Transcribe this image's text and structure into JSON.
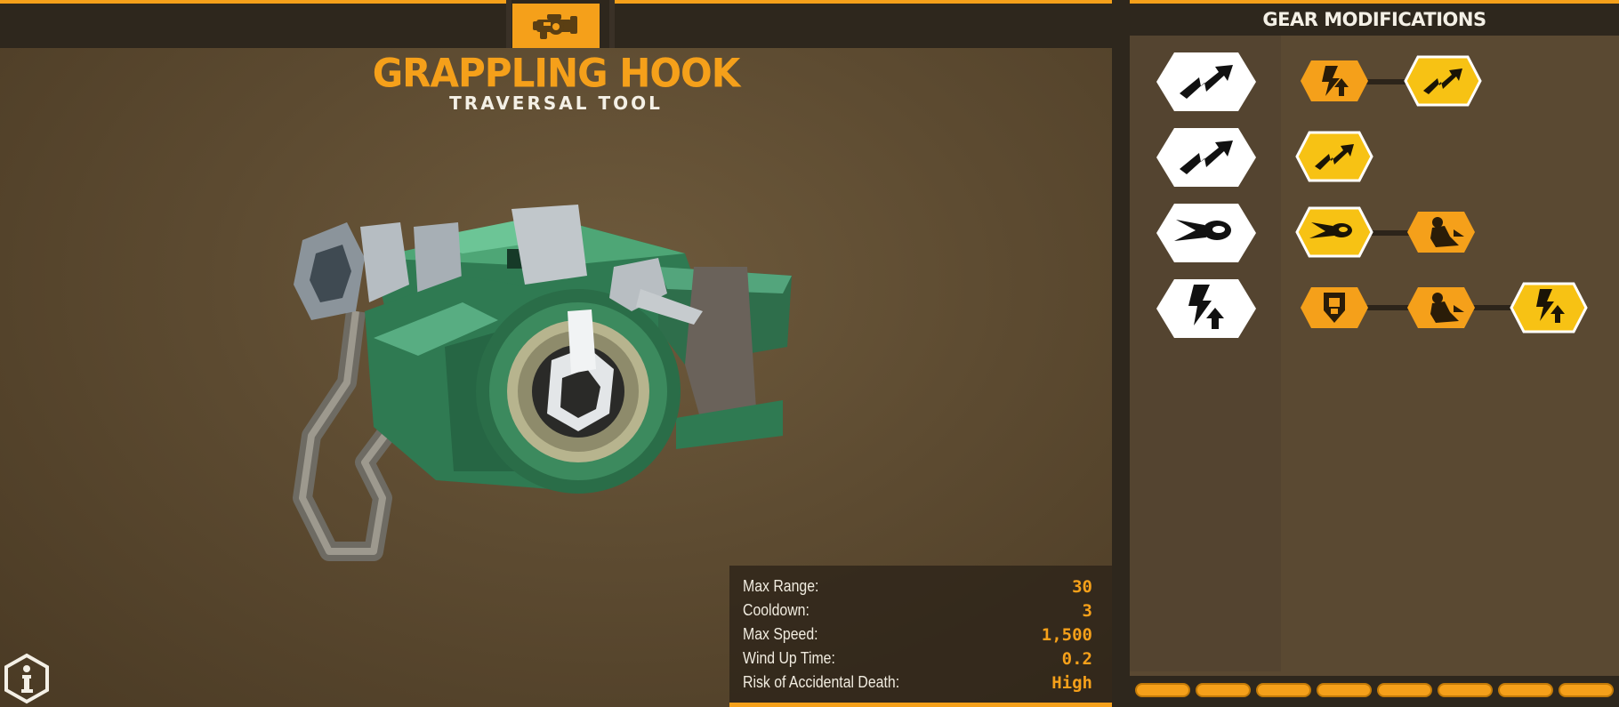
{
  "item": {
    "title": "GRAPPLING HOOK",
    "subtitle": "TRAVERSAL TOOL",
    "category_icon": "gadget-category-icon"
  },
  "stats": [
    {
      "label": "Max Range:",
      "value": "30"
    },
    {
      "label": "Cooldown:",
      "value": "3"
    },
    {
      "label": "Max Speed:",
      "value": "1,500"
    },
    {
      "label": "Wind Up Time:",
      "value": "0.2"
    },
    {
      "label": "Risk of Accidental Death:",
      "value": "High"
    }
  ],
  "panel": {
    "title": "GEAR MODIFICATIONS",
    "rows": [
      {
        "base": "zigzag-arrow-icon",
        "mods": [
          {
            "icon": "lightning-up-icon",
            "style": "orange"
          },
          {
            "icon": "zigzag-arrow-icon",
            "style": "yellow-selected"
          }
        ]
      },
      {
        "base": "zigzag-arrow-icon",
        "mods": [
          {
            "icon": "zigzag-arrow-icon",
            "style": "yellow-selected"
          }
        ]
      },
      {
        "base": "comet-icon",
        "mods": [
          {
            "icon": "comet-icon",
            "style": "yellow-selected"
          },
          {
            "icon": "dash-figure-icon",
            "style": "orange"
          }
        ]
      },
      {
        "base": "lightning-up-icon",
        "mods": [
          {
            "icon": "shield-fist-icon",
            "style": "orange"
          },
          {
            "icon": "dash-figure-icon",
            "style": "orange"
          },
          {
            "icon": "lightning-up-icon",
            "style": "yellow-selected"
          }
        ]
      }
    ]
  },
  "colors": {
    "accent": "#f5a01a",
    "selected": "#f7c214",
    "bar": "#2e271d",
    "panel": "#5a4932"
  }
}
